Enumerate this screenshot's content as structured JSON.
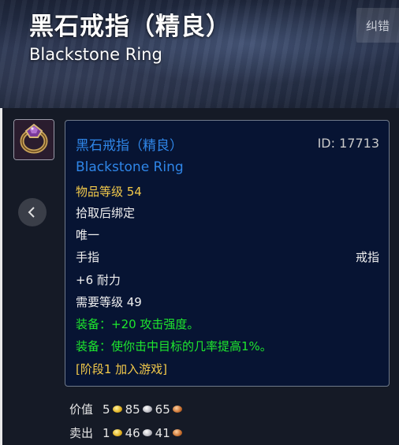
{
  "header": {
    "title": "黑石戒指（精良）",
    "subtitle": "Blackstone Ring",
    "correction_button": "纠错"
  },
  "item": {
    "icon": "ring-icon",
    "name_cn": "黑石戒指（精良）",
    "id_label": "ID: 17713",
    "name_en": "Blackstone Ring",
    "item_level": "物品等级 54",
    "binding": "拾取后绑定",
    "unique": "唯一",
    "slot_left": "手指",
    "slot_right": "戒指",
    "stat": "+6 耐力",
    "required_level": "需要等级 49",
    "equip1": "装备：+20 攻击强度。",
    "equip2": "装备：使你击中目标的几率提高1%。",
    "phase": "[阶段1 加入游戏]",
    "quality_color": "#2f86e8",
    "equip_color": "#1ee82e",
    "level_color": "#f2c94a"
  },
  "prices": {
    "value_label": "价值",
    "value_gold": "5",
    "value_silver": "85",
    "value_copper": "65",
    "sell_label": "卖出",
    "sell_gold": "1",
    "sell_silver": "46",
    "sell_copper": "41"
  }
}
